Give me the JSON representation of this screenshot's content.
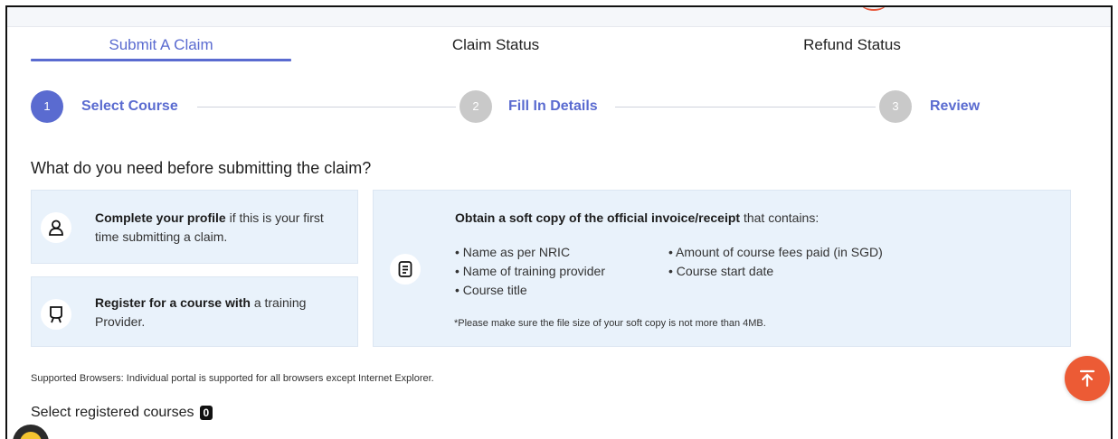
{
  "tabs": [
    {
      "label": "Submit A Claim",
      "active": true
    },
    {
      "label": "Claim Status",
      "active": false
    },
    {
      "label": "Refund Status",
      "active": false
    }
  ],
  "steps": [
    {
      "number": "1",
      "label": "Select Course",
      "active": true
    },
    {
      "number": "2",
      "label": "Fill In Details",
      "active": false
    },
    {
      "number": "3",
      "label": "Review",
      "active": false
    }
  ],
  "prereq_title": "What do you need before submitting the claim?",
  "cards": {
    "profile": {
      "bold": "Complete your profile",
      "rest": " if this is your first time submitting a claim.",
      "icon": "person-icon"
    },
    "register": {
      "bold": "Register for a course with",
      "rest": " a training Provider.",
      "icon": "award-icon"
    },
    "invoice": {
      "bold": "Obtain a soft copy of the official invoice/receipt",
      "rest": " that contains:",
      "icon": "document-icon",
      "bullets_left": [
        "Name as per NRIC",
        "Name of training provider",
        "Course title"
      ],
      "bullets_right": [
        "Amount of course fees paid (in SGD)",
        "Course start date"
      ],
      "note": "*Please make sure the file size of your soft copy is not more than 4MB."
    }
  },
  "supported_browsers": "Supported Browsers: Individual portal is supported for all browsers except Internet Explorer.",
  "select_registered": {
    "label": "Select registered courses",
    "count": "0"
  },
  "colors": {
    "accent": "#5a6bd0",
    "inactive_step": "#c9c9c9",
    "card_bg": "#e9f2fb",
    "scroll_top_button": "#ec5b35"
  }
}
